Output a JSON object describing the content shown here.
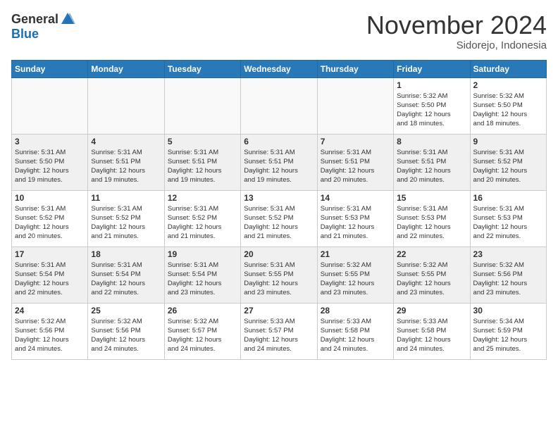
{
  "header": {
    "logo_general": "General",
    "logo_blue": "Blue",
    "month_title": "November 2024",
    "location": "Sidorejo, Indonesia"
  },
  "weekdays": [
    "Sunday",
    "Monday",
    "Tuesday",
    "Wednesday",
    "Thursday",
    "Friday",
    "Saturday"
  ],
  "weeks": [
    [
      {
        "day": "",
        "info": ""
      },
      {
        "day": "",
        "info": ""
      },
      {
        "day": "",
        "info": ""
      },
      {
        "day": "",
        "info": ""
      },
      {
        "day": "",
        "info": ""
      },
      {
        "day": "1",
        "info": "Sunrise: 5:32 AM\nSunset: 5:50 PM\nDaylight: 12 hours\nand 18 minutes."
      },
      {
        "day": "2",
        "info": "Sunrise: 5:32 AM\nSunset: 5:50 PM\nDaylight: 12 hours\nand 18 minutes."
      }
    ],
    [
      {
        "day": "3",
        "info": "Sunrise: 5:31 AM\nSunset: 5:50 PM\nDaylight: 12 hours\nand 19 minutes."
      },
      {
        "day": "4",
        "info": "Sunrise: 5:31 AM\nSunset: 5:51 PM\nDaylight: 12 hours\nand 19 minutes."
      },
      {
        "day": "5",
        "info": "Sunrise: 5:31 AM\nSunset: 5:51 PM\nDaylight: 12 hours\nand 19 minutes."
      },
      {
        "day": "6",
        "info": "Sunrise: 5:31 AM\nSunset: 5:51 PM\nDaylight: 12 hours\nand 19 minutes."
      },
      {
        "day": "7",
        "info": "Sunrise: 5:31 AM\nSunset: 5:51 PM\nDaylight: 12 hours\nand 20 minutes."
      },
      {
        "day": "8",
        "info": "Sunrise: 5:31 AM\nSunset: 5:51 PM\nDaylight: 12 hours\nand 20 minutes."
      },
      {
        "day": "9",
        "info": "Sunrise: 5:31 AM\nSunset: 5:52 PM\nDaylight: 12 hours\nand 20 minutes."
      }
    ],
    [
      {
        "day": "10",
        "info": "Sunrise: 5:31 AM\nSunset: 5:52 PM\nDaylight: 12 hours\nand 20 minutes."
      },
      {
        "day": "11",
        "info": "Sunrise: 5:31 AM\nSunset: 5:52 PM\nDaylight: 12 hours\nand 21 minutes."
      },
      {
        "day": "12",
        "info": "Sunrise: 5:31 AM\nSunset: 5:52 PM\nDaylight: 12 hours\nand 21 minutes."
      },
      {
        "day": "13",
        "info": "Sunrise: 5:31 AM\nSunset: 5:52 PM\nDaylight: 12 hours\nand 21 minutes."
      },
      {
        "day": "14",
        "info": "Sunrise: 5:31 AM\nSunset: 5:53 PM\nDaylight: 12 hours\nand 21 minutes."
      },
      {
        "day": "15",
        "info": "Sunrise: 5:31 AM\nSunset: 5:53 PM\nDaylight: 12 hours\nand 22 minutes."
      },
      {
        "day": "16",
        "info": "Sunrise: 5:31 AM\nSunset: 5:53 PM\nDaylight: 12 hours\nand 22 minutes."
      }
    ],
    [
      {
        "day": "17",
        "info": "Sunrise: 5:31 AM\nSunset: 5:54 PM\nDaylight: 12 hours\nand 22 minutes."
      },
      {
        "day": "18",
        "info": "Sunrise: 5:31 AM\nSunset: 5:54 PM\nDaylight: 12 hours\nand 22 minutes."
      },
      {
        "day": "19",
        "info": "Sunrise: 5:31 AM\nSunset: 5:54 PM\nDaylight: 12 hours\nand 23 minutes."
      },
      {
        "day": "20",
        "info": "Sunrise: 5:31 AM\nSunset: 5:55 PM\nDaylight: 12 hours\nand 23 minutes."
      },
      {
        "day": "21",
        "info": "Sunrise: 5:32 AM\nSunset: 5:55 PM\nDaylight: 12 hours\nand 23 minutes."
      },
      {
        "day": "22",
        "info": "Sunrise: 5:32 AM\nSunset: 5:55 PM\nDaylight: 12 hours\nand 23 minutes."
      },
      {
        "day": "23",
        "info": "Sunrise: 5:32 AM\nSunset: 5:56 PM\nDaylight: 12 hours\nand 23 minutes."
      }
    ],
    [
      {
        "day": "24",
        "info": "Sunrise: 5:32 AM\nSunset: 5:56 PM\nDaylight: 12 hours\nand 24 minutes."
      },
      {
        "day": "25",
        "info": "Sunrise: 5:32 AM\nSunset: 5:56 PM\nDaylight: 12 hours\nand 24 minutes."
      },
      {
        "day": "26",
        "info": "Sunrise: 5:32 AM\nSunset: 5:57 PM\nDaylight: 12 hours\nand 24 minutes."
      },
      {
        "day": "27",
        "info": "Sunrise: 5:33 AM\nSunset: 5:57 PM\nDaylight: 12 hours\nand 24 minutes."
      },
      {
        "day": "28",
        "info": "Sunrise: 5:33 AM\nSunset: 5:58 PM\nDaylight: 12 hours\nand 24 minutes."
      },
      {
        "day": "29",
        "info": "Sunrise: 5:33 AM\nSunset: 5:58 PM\nDaylight: 12 hours\nand 24 minutes."
      },
      {
        "day": "30",
        "info": "Sunrise: 5:34 AM\nSunset: 5:59 PM\nDaylight: 12 hours\nand 25 minutes."
      }
    ]
  ]
}
